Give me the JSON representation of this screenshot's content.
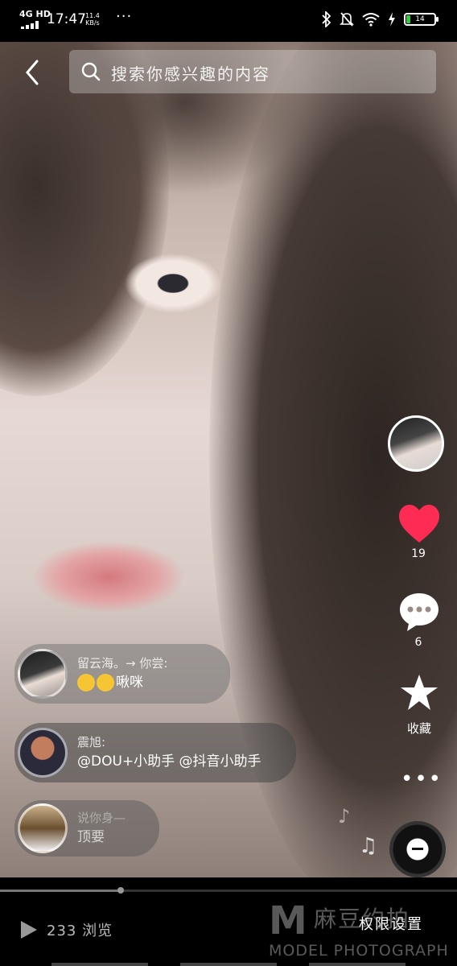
{
  "status_bar": {
    "network": "4G HD",
    "time": "17:47",
    "speed_value": "11.4",
    "speed_unit": "KB/s",
    "more": "···",
    "battery": "14"
  },
  "search": {
    "placeholder": "搜索你感兴趣的内容"
  },
  "rail": {
    "like_count": "19",
    "comment_count": "6",
    "favorite_label": "收藏",
    "more": "•••"
  },
  "comments": [
    {
      "name": "留云海。→ 你尝:",
      "message": "啾咪"
    },
    {
      "name": "震旭:",
      "message": "@DOU+小助手 @抖音小助手"
    },
    {
      "name": "说你身—",
      "message": "顶要"
    }
  ],
  "bottom": {
    "views": "233 浏览",
    "permission": "权限设置"
  },
  "watermark": {
    "mark": "M",
    "cn": "麻豆约拍",
    "en": "MODEL PHOTOGRAPH"
  },
  "colors": {
    "like": "#fe2c55",
    "battery_fill": "#2ecc40"
  }
}
